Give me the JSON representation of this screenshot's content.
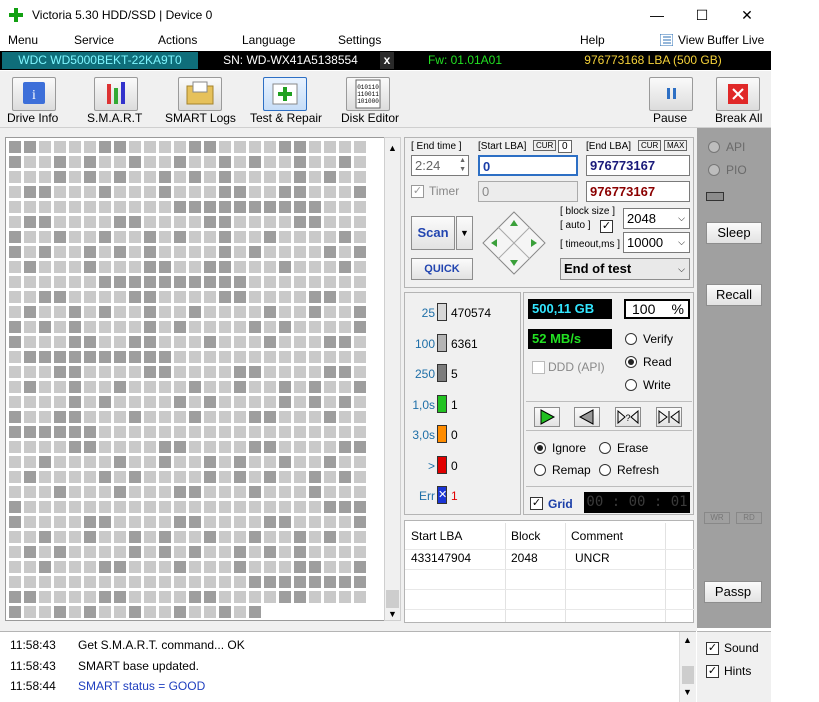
{
  "window": {
    "title": "Victoria 5.30 HDD/SSD | Device 0",
    "minimize": "—",
    "maximize": "☐",
    "close": "✕"
  },
  "menu": {
    "items": [
      "Menu",
      "Service",
      "Actions",
      "Language",
      "Settings",
      "Help"
    ],
    "view_buffer": "View Buffer Live"
  },
  "drive": {
    "model": "WDC WD5000BEKT-22KA9T0",
    "serial": "SN: WD-WX41A5138554",
    "x": "x",
    "firmware": "Fw: 01.01A01",
    "lba": "976773168 LBA (500 GB)"
  },
  "toolbar": {
    "drive_info": "Drive Info",
    "smart": "S.M.A.R.T",
    "smart_logs": "SMART Logs",
    "test_repair": "Test & Repair",
    "disk_editor": "Disk Editor",
    "pause": "Pause",
    "break_all": "Break All"
  },
  "test": {
    "end_time_label": "[ End time ]",
    "start_lba_label": "[Start LBA]",
    "cur_label": "CUR",
    "cur_value": "0",
    "end_lba_label": "[End LBA]",
    "cur2_label": "CUR",
    "max_label": "MAX",
    "end_time_value": "2:24",
    "start_lba_value": "0",
    "end_lba_value": "976773167",
    "timer_label": "Timer",
    "start_lba_2": "0",
    "end_lba_2": "976773167",
    "scan": "Scan",
    "quick": "QUICK",
    "block_size_label": "[ block size ]",
    "auto_label": "[ auto ]",
    "block_size_value": "2048",
    "timeout_label": "[ timeout,ms ]",
    "timeout_value": "10000",
    "end_mode": "End of test"
  },
  "legend": [
    {
      "ms": "25",
      "count": "470574",
      "color": "#d8d8d8"
    },
    {
      "ms": "100",
      "count": "6361",
      "color": "#b4b4b4"
    },
    {
      "ms": "250",
      "count": "5",
      "color": "#7c7c7c"
    },
    {
      "ms": "1,0s",
      "count": "1",
      "color": "#22c222"
    },
    {
      "ms": "3,0s",
      "count": "0",
      "color": "#ff8c00"
    },
    {
      "ms": ">",
      "count": "0",
      "color": "#e00000"
    },
    {
      "ms": "Err",
      "count": "1",
      "color": "#1a35d6"
    }
  ],
  "stats": {
    "size": "500,11 GB",
    "percent": "100",
    "percent_sign": "%",
    "speed": "52 MB/s",
    "ddd": "DDD (API)",
    "verify": "Verify",
    "read": "Read",
    "write": "Write",
    "ignore": "Ignore",
    "erase": "Erase",
    "remap": "Remap",
    "refresh": "Refresh",
    "grid": "Grid",
    "elapsed": "00 : 00 : 01"
  },
  "results": {
    "headers": [
      "Start LBA",
      "Block",
      "Comment"
    ],
    "rows": [
      {
        "start_lba": "433147904",
        "block": "2048",
        "comment": "UNCR"
      }
    ]
  },
  "side": {
    "api": "API",
    "pio": "PIO",
    "sleep": "Sleep",
    "recall": "Recall",
    "wr": "WR",
    "rd": "RD",
    "passp": "Passp",
    "sound": "Sound",
    "hints": "Hints"
  },
  "log": [
    {
      "time": "11:58:43",
      "text": "Get S.M.A.R.T. command... OK",
      "color": "#000000"
    },
    {
      "time": "11:58:43",
      "text": "SMART base updated.",
      "color": "#000000"
    },
    {
      "time": "11:58:44",
      "text": "SMART status = GOOD",
      "color": "#1f3fbf"
    }
  ]
}
